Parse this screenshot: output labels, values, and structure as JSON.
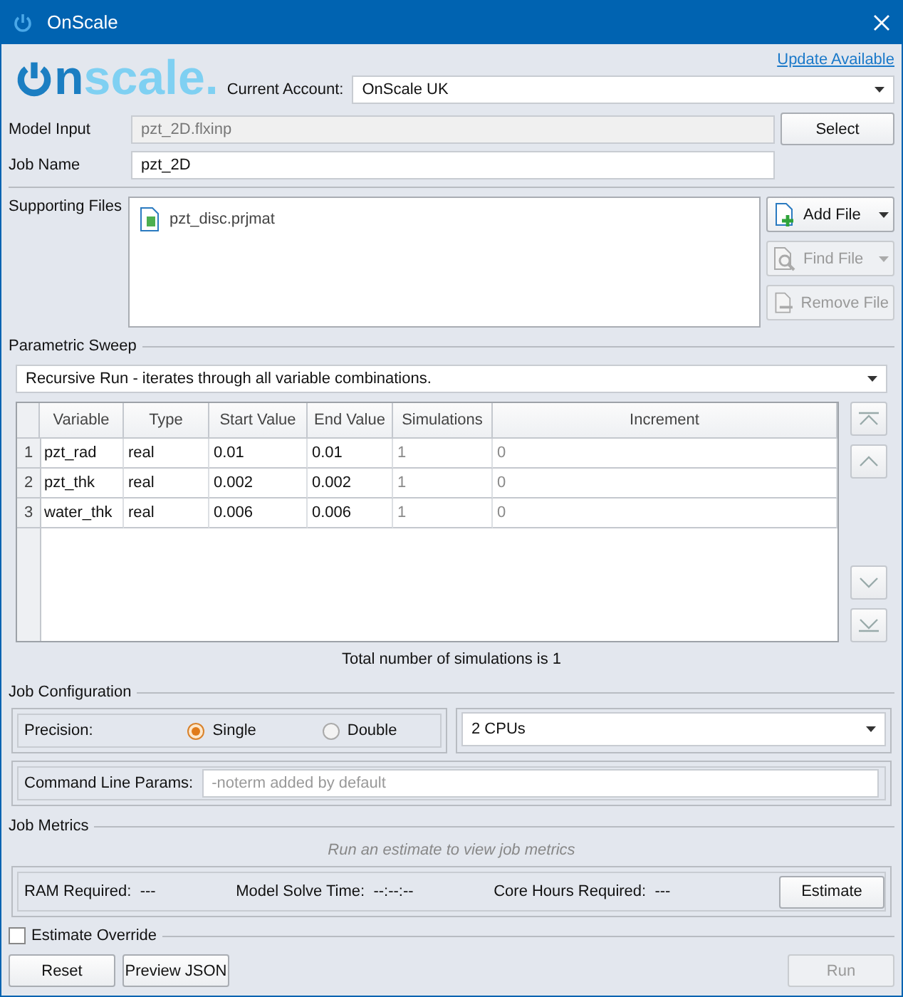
{
  "window": {
    "title": "OnScale"
  },
  "header": {
    "logo_text": "nscale.",
    "update_link": "Update Available",
    "account_label": "Current Account:",
    "account_value": "OnScale UK"
  },
  "model_input": {
    "label": "Model Input",
    "value": "pzt_2D.flxinp",
    "disabled": true,
    "button": "Select"
  },
  "job_name": {
    "label": "Job Name",
    "value": "pzt_2D"
  },
  "supporting_files": {
    "label": "Supporting Files",
    "files": [
      "pzt_disc.prjmat"
    ],
    "buttons": [
      {
        "label": "Add File",
        "kind": "add",
        "dropdown": true,
        "disabled": false
      },
      {
        "label": "Find File",
        "kind": "find",
        "dropdown": true,
        "disabled": true
      },
      {
        "label": "Remove File",
        "kind": "remove",
        "dropdown": false,
        "disabled": true
      }
    ]
  },
  "parametric_sweep": {
    "title": "Parametric Sweep",
    "mode": "Recursive Run  -  iterates through all variable combinations.",
    "table": {
      "columns": [
        {
          "label": "Variable",
          "muted": false
        },
        {
          "label": "Type",
          "muted": false
        },
        {
          "label": "Start Value",
          "muted": false
        },
        {
          "label": "End Value",
          "muted": false
        },
        {
          "label": "Simulations",
          "muted": true
        },
        {
          "label": "Increment",
          "muted": true
        }
      ],
      "rows": [
        {
          "index": "1",
          "cells": [
            "pzt_rad",
            "real",
            "0.01",
            "0.01",
            "1",
            "0"
          ]
        },
        {
          "index": "2",
          "cells": [
            "pzt_thk",
            "real",
            "0.002",
            "0.002",
            "1",
            "0"
          ]
        },
        {
          "index": "3",
          "cells": [
            "water_thk",
            "real",
            "0.006",
            "0.006",
            "1",
            "0"
          ]
        }
      ]
    },
    "total": "Total number of simulations is 1"
  },
  "job_configuration": {
    "title": "Job Configuration",
    "precision_label": "Precision:",
    "options": [
      {
        "label": "Single",
        "selected": true
      },
      {
        "label": "Double",
        "selected": false
      }
    ],
    "cpus": "2 CPUs",
    "cmd_label": "Command Line Params:",
    "cmd_placeholder": "-noterm added by default"
  },
  "job_metrics": {
    "title": "Job Metrics",
    "hint": "Run an estimate to view job metrics",
    "metrics": [
      {
        "label": "RAM Required:",
        "value": "---"
      },
      {
        "label": "Model Solve Time:",
        "value": "--:--:--"
      },
      {
        "label": "Core Hours Required:",
        "value": "---"
      }
    ],
    "estimate_button": "Estimate"
  },
  "estimate_override": {
    "label": "Estimate Override",
    "checked": false
  },
  "footer_buttons": [
    {
      "label": "Reset",
      "disabled": false
    },
    {
      "label": "Preview JSON",
      "disabled": false
    },
    {
      "label": "Run",
      "disabled": true
    }
  ]
}
